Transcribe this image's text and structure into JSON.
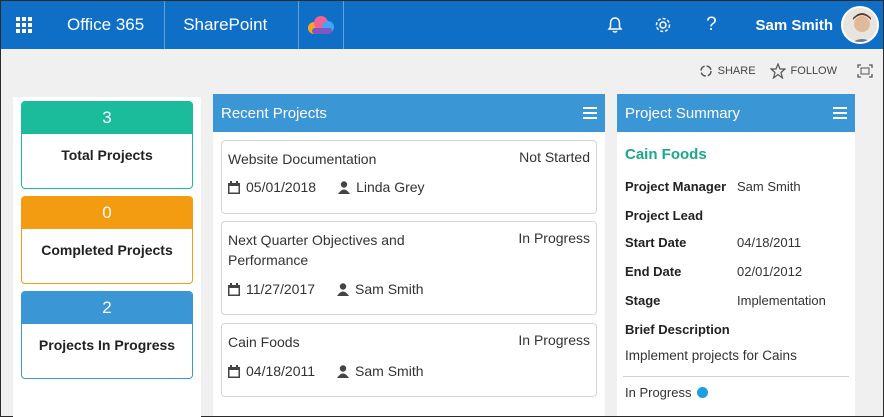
{
  "topbar": {
    "brand": "Office 365",
    "app": "SharePoint",
    "user_name": "Sam Smith",
    "help_label": "?"
  },
  "actions": {
    "share_label": "SHARE",
    "follow_label": "FOLLOW"
  },
  "stats": [
    {
      "value": "3",
      "label": "Total Projects",
      "color": "#1abc9c"
    },
    {
      "value": "0",
      "label": "Completed Projects",
      "color": "#f39c12"
    },
    {
      "value": "2",
      "label": "Projects In Progress",
      "color": "#3b96d6"
    }
  ],
  "recent": {
    "title": "Recent Projects",
    "projects": [
      {
        "name": "Website Documentation",
        "status": "Not Started",
        "date": "05/01/2018",
        "owner": "Linda Grey"
      },
      {
        "name": "Next Quarter Objectives and Performance",
        "status": "In Progress",
        "date": "11/27/2017",
        "owner": "Sam Smith"
      },
      {
        "name": "Cain Foods",
        "status": "In Progress",
        "date": "04/18/2011",
        "owner": "Sam Smith"
      }
    ]
  },
  "summary": {
    "title": "Project Summary",
    "project_name": "Cain Foods",
    "manager_label": "Project Manager",
    "manager_value": "Sam Smith",
    "lead_label": "Project Lead",
    "start_label": "Start Date",
    "start_value": "04/18/2011",
    "end_label": "End Date",
    "end_value": "02/01/2012",
    "stage_label": "Stage",
    "stage_value": "Implementation",
    "desc_label": "Brief Description",
    "desc_value": "Implement projects for Cains",
    "status": "In Progress",
    "status_color": "#1aa0e0"
  },
  "colors": {
    "suitebar": "#0f6fc6",
    "panel_header": "#3b96d6",
    "summary_accent": "#1ba88a"
  }
}
